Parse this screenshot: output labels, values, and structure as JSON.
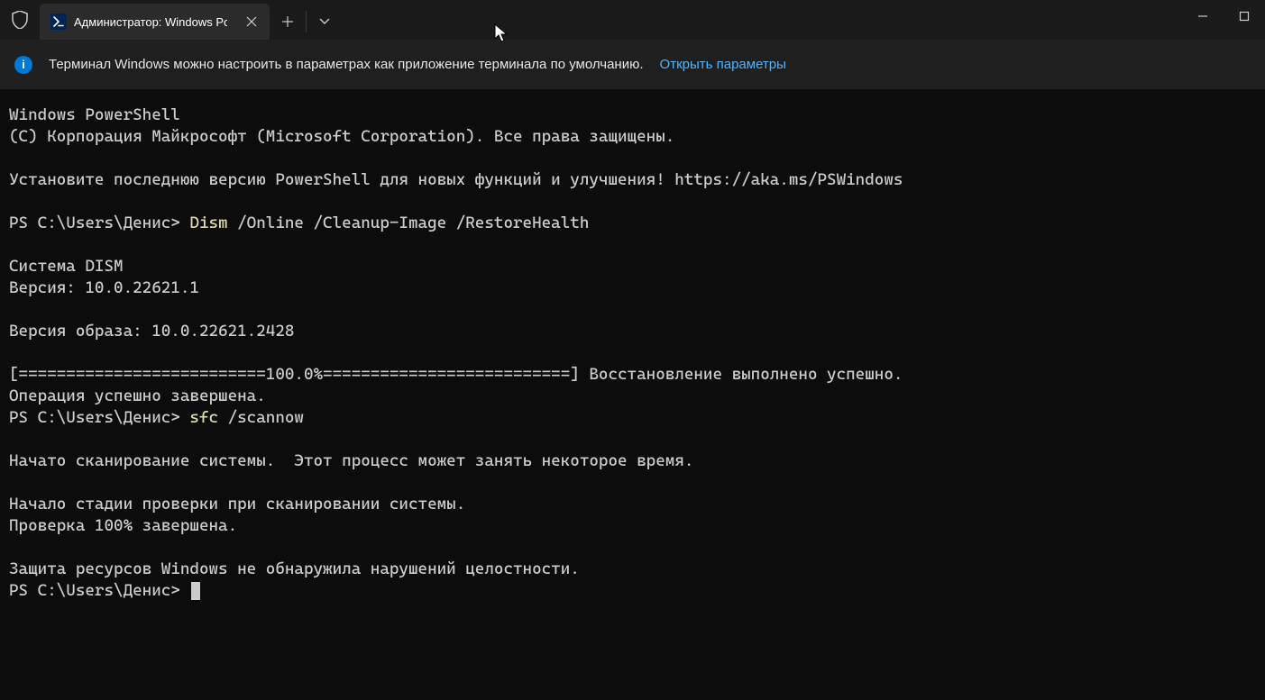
{
  "titlebar": {
    "tab_title": "Администратор: Windows Po"
  },
  "infobar": {
    "text": "Терминал Windows можно настроить в параметрах как приложение терминала по умолчанию.",
    "link": "Открыть параметры"
  },
  "terminal": {
    "l1": "Windows PowerShell",
    "l2": "(C) Корпорация Майкрософт (Microsoft Corporation). Все права защищены.",
    "blank": "",
    "l3": "Установите последнюю версию PowerShell для новых функций и улучшения! https://aka.ms/PSWindows",
    "prompt1_path": "PS C:\\Users\\Денис> ",
    "cmd1_name": "Dism",
    "cmd1_args": " /Online /Cleanup-Image /RestoreHealth",
    "l5": "Cистема DISM",
    "l6": "Версия: 10.0.22621.1",
    "l7": "Версия образа: 10.0.22621.2428",
    "l8": "[==========================100.0%==========================] Восстановление выполнено успешно.",
    "l9": "Операция успешно завершена.",
    "prompt2_path": "PS C:\\Users\\Денис> ",
    "cmd2_name": "sfc",
    "cmd2_args": " /scannow",
    "l10": "Начато сканирование системы.  Этот процесс может занять некоторое время.",
    "l11": "Начало стадии проверки при сканировании системы.",
    "l12": "Проверка 100% завершена.",
    "l13": "Защита ресурсов Windows не обнаружила нарушений целостности.",
    "prompt3_path": "PS C:\\Users\\Денис> "
  }
}
